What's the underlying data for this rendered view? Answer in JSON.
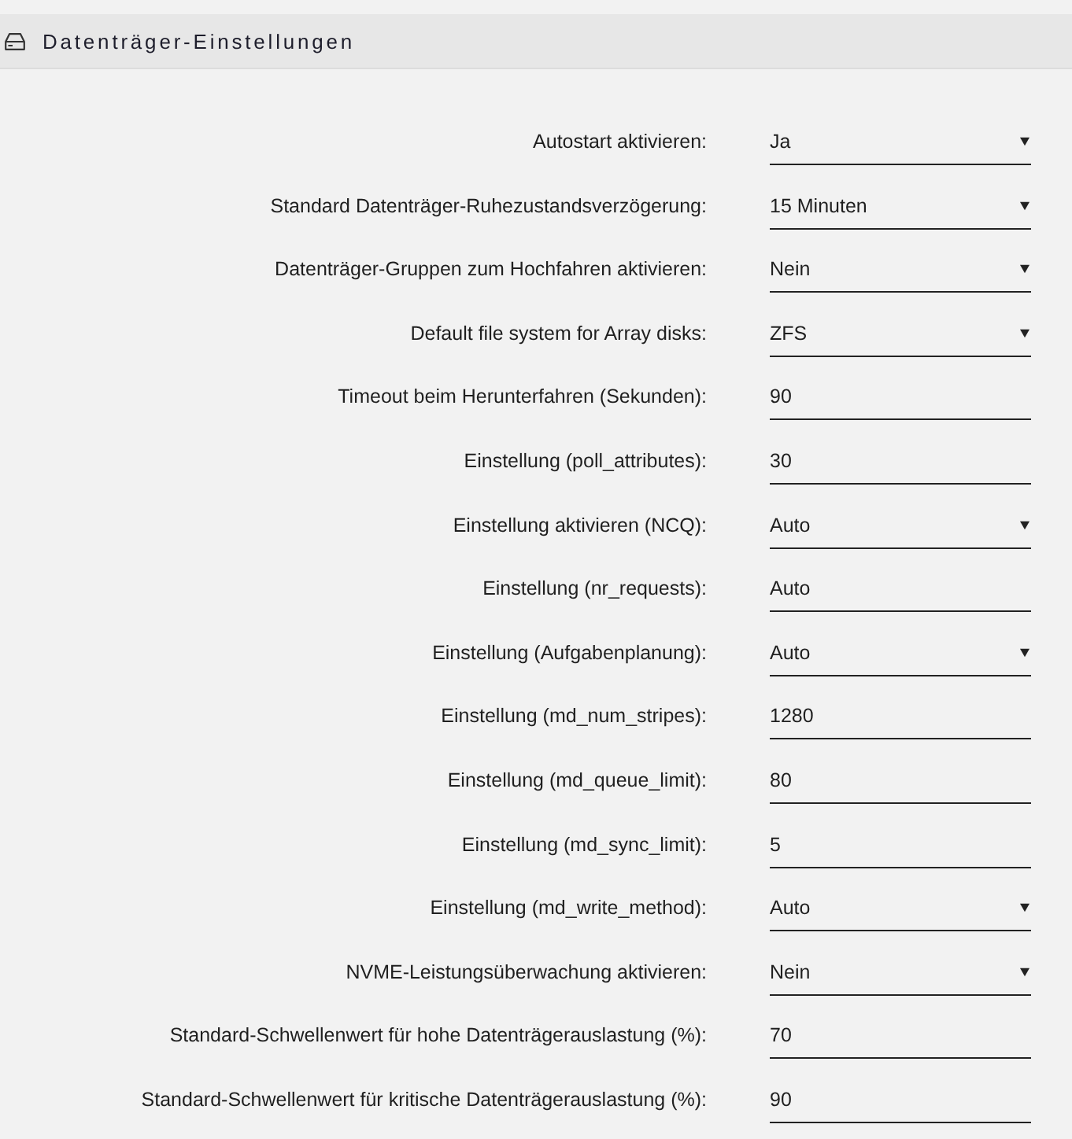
{
  "section": {
    "title": "Datenträger-Einstellungen"
  },
  "settings": [
    {
      "label": "Autostart aktivieren:",
      "kind": "select",
      "value": "Ja"
    },
    {
      "label": "Standard Datenträger-Ruhezustandsverzögerung:",
      "kind": "select",
      "value": "15 Minuten"
    },
    {
      "label": "Datenträger-Gruppen zum Hochfahren aktivieren:",
      "kind": "select",
      "value": "Nein"
    },
    {
      "label": "Default file system for Array disks:",
      "kind": "select",
      "value": "ZFS"
    },
    {
      "label": "Timeout beim Herunterfahren (Sekunden):",
      "kind": "input",
      "value": "90"
    },
    {
      "label": "Einstellung (poll_attributes):",
      "kind": "input",
      "value": "30"
    },
    {
      "label": "Einstellung aktivieren (NCQ):",
      "kind": "select",
      "value": "Auto"
    },
    {
      "label": "Einstellung (nr_requests):",
      "kind": "input",
      "value": "Auto"
    },
    {
      "label": "Einstellung (Aufgabenplanung):",
      "kind": "select",
      "value": "Auto"
    },
    {
      "label": "Einstellung (md_num_stripes):",
      "kind": "input",
      "value": "1280"
    },
    {
      "label": "Einstellung (md_queue_limit):",
      "kind": "input",
      "value": "80"
    },
    {
      "label": "Einstellung (md_sync_limit):",
      "kind": "input",
      "value": "5"
    },
    {
      "label": "Einstellung (md_write_method):",
      "kind": "select",
      "value": "Auto"
    },
    {
      "label": "NVME-Leistungsüberwachung aktivieren:",
      "kind": "select",
      "value": "Nein"
    },
    {
      "label": "Standard-Schwellenwert für hohe Datenträgerauslastung (%):",
      "kind": "input",
      "value": "70"
    },
    {
      "label": "Standard-Schwellenwert für kritische Datenträgerauslastung (%):",
      "kind": "input",
      "value": "90"
    }
  ]
}
